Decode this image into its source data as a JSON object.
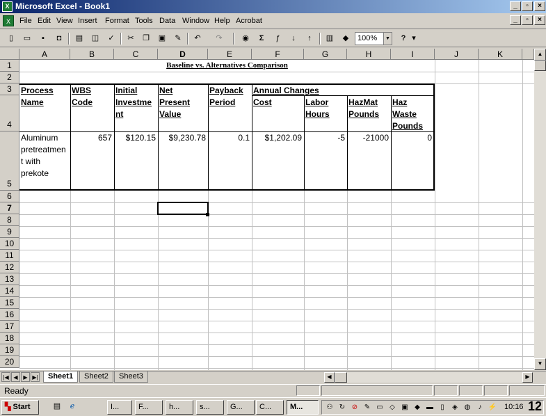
{
  "window": {
    "title": "Microsoft Excel - Book1",
    "min": "_",
    "max": "▫",
    "close": "×"
  },
  "menu": {
    "items": [
      "File",
      "Edit",
      "View",
      "Insert",
      "Format",
      "Tools",
      "Data",
      "Window",
      "Help",
      "Acrobat"
    ]
  },
  "toolbar": {
    "zoom": "100%"
  },
  "columns": [
    "A",
    "B",
    "C",
    "D",
    "E",
    "F",
    "G",
    "H",
    "I",
    "J",
    "K"
  ],
  "rows": [
    "1",
    "2",
    "3",
    "4",
    "5",
    "6",
    "7",
    "8",
    "9",
    "10",
    "11",
    "12",
    "13",
    "14",
    "15",
    "16",
    "17",
    "18",
    "19",
    "20"
  ],
  "sheet": {
    "title": "Baseline vs. Alternatives Comparison",
    "headers": {
      "process_name": [
        "Process",
        "Name"
      ],
      "wbs_code": [
        "WBS",
        "Code"
      ],
      "initial_investment": [
        "Initial",
        "Investme",
        "nt"
      ],
      "npv": [
        "Net",
        "Present",
        "Value"
      ],
      "payback": [
        "Payback",
        "Period"
      ],
      "annual_changes": "Annual Changes",
      "cost": "Cost",
      "labor": [
        "Labor",
        "Hours"
      ],
      "hazmat": [
        "HazMat",
        "Pounds"
      ],
      "haz_waste": [
        "Haz",
        "Waste",
        "Pounds"
      ]
    },
    "row5": {
      "process": [
        "Aluminum",
        "pretreatmen",
        "t with",
        "prekote"
      ],
      "wbs": "657",
      "investment": "$120.15",
      "npv": "$9,230.78",
      "payback": "0.1",
      "cost": "$1,202.09",
      "labor": "-5",
      "hazmat": "-21000",
      "haz_waste": "0"
    }
  },
  "tabs": [
    "Sheet1",
    "Sheet2",
    "Sheet3"
  ],
  "status": "Ready",
  "taskbar": {
    "start": "Start",
    "buttons": [
      "I...",
      "F...",
      "h...",
      "s...",
      "G...",
      "C...",
      "M..."
    ],
    "clock": "10:16",
    "overlay": "12"
  }
}
